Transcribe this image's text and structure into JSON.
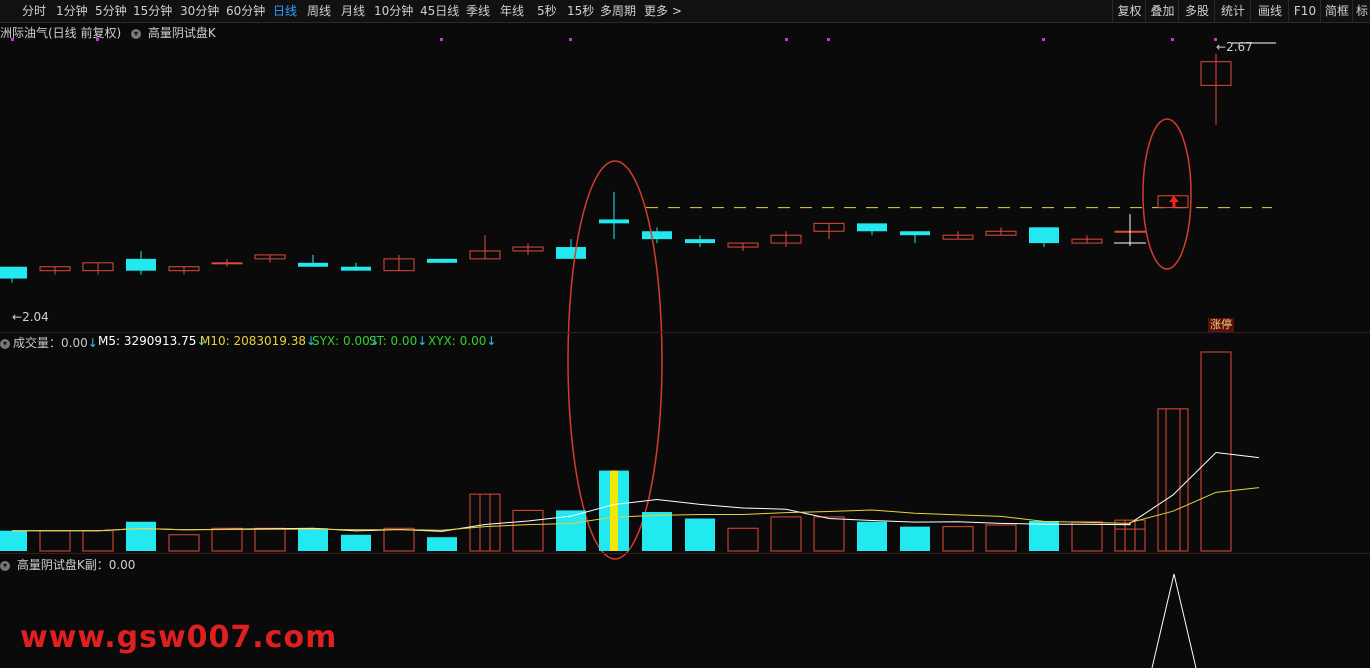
{
  "toolbar": {
    "tabs": [
      "分时",
      "1分钟",
      "5分钟",
      "15分钟",
      "30分钟",
      "60分钟",
      "日线",
      "周线",
      "月线",
      "10分钟",
      "45日线",
      "季线",
      "年线",
      "5秒",
      "15秒",
      "多周期",
      "更多 >"
    ],
    "active_tab": "日线",
    "right_buttons": [
      "复权",
      "叠加",
      "多股",
      "统计",
      "画线",
      "F10",
      "简框",
      "标"
    ]
  },
  "main_chart": {
    "title": "洲际油气(日线 前复权)",
    "indicator_name": "高量阴试盘K",
    "high_label": "2.67",
    "low_label": "2.04",
    "badge": "涨停",
    "colors": {
      "up": "#e04a3a",
      "down": "#22e8f0",
      "dash": "#e8d23a",
      "ellipse": "#d43a30"
    }
  },
  "volume_panel": {
    "items": [
      {
        "label": "成交量：0.00",
        "color": "#c8c8c8"
      },
      {
        "label": "M5: 3290913.75",
        "color": "#ffffff"
      },
      {
        "label": "M10: 2083019.38",
        "color": "#e8d23a"
      },
      {
        "label": "SYX: 0.00",
        "color": "#30d030"
      },
      {
        "label": "ST: 0.00",
        "color": "#30d030"
      },
      {
        "label": "XYX: 0.00",
        "color": "#30d030"
      }
    ]
  },
  "sub_panel": {
    "label": "高量阴试盘K副：0.00"
  },
  "watermark": "www.gsw007.com",
  "chart_data": {
    "type": "candlestick",
    "ylim": [
      2.0,
      2.7
    ],
    "candles": [
      {
        "o": 2.13,
        "c": 2.1,
        "h": 2.13,
        "l": 2.09
      },
      {
        "o": 2.12,
        "c": 2.13,
        "h": 2.13,
        "l": 2.11
      },
      {
        "o": 2.12,
        "c": 2.14,
        "h": 2.14,
        "l": 2.11
      },
      {
        "o": 2.15,
        "c": 2.12,
        "h": 2.17,
        "l": 2.11
      },
      {
        "o": 2.12,
        "c": 2.13,
        "h": 2.13,
        "l": 2.11
      },
      {
        "o": 2.14,
        "c": 2.14,
        "h": 2.15,
        "l": 2.13
      },
      {
        "o": 2.15,
        "c": 2.16,
        "h": 2.16,
        "l": 2.14
      },
      {
        "o": 2.14,
        "c": 2.13,
        "h": 2.16,
        "l": 2.13
      },
      {
        "o": 2.13,
        "c": 2.12,
        "h": 2.14,
        "l": 2.12
      },
      {
        "o": 2.12,
        "c": 2.15,
        "h": 2.16,
        "l": 2.12
      },
      {
        "o": 2.15,
        "c": 2.14,
        "h": 2.15,
        "l": 2.14
      },
      {
        "o": 2.15,
        "c": 2.17,
        "h": 2.21,
        "l": 2.15
      },
      {
        "o": 2.17,
        "c": 2.18,
        "h": 2.19,
        "l": 2.16
      },
      {
        "o": 2.18,
        "c": 2.15,
        "h": 2.2,
        "l": 2.15
      },
      {
        "o": 2.25,
        "c": 2.24,
        "h": 2.32,
        "l": 2.2
      },
      {
        "o": 2.22,
        "c": 2.2,
        "h": 2.23,
        "l": 2.19
      },
      {
        "o": 2.2,
        "c": 2.19,
        "h": 2.21,
        "l": 2.18
      },
      {
        "o": 2.18,
        "c": 2.19,
        "h": 2.19,
        "l": 2.17
      },
      {
        "o": 2.19,
        "c": 2.21,
        "h": 2.22,
        "l": 2.18
      },
      {
        "o": 2.22,
        "c": 2.24,
        "h": 2.24,
        "l": 2.2
      },
      {
        "o": 2.24,
        "c": 2.22,
        "h": 2.24,
        "l": 2.21
      },
      {
        "o": 2.22,
        "c": 2.21,
        "h": 2.22,
        "l": 2.19
      },
      {
        "o": 2.2,
        "c": 2.21,
        "h": 2.22,
        "l": 2.2
      },
      {
        "o": 2.21,
        "c": 2.22,
        "h": 2.23,
        "l": 2.21
      },
      {
        "o": 2.23,
        "c": 2.19,
        "h": 2.23,
        "l": 2.18
      },
      {
        "o": 2.19,
        "c": 2.2,
        "h": 2.21,
        "l": 2.19
      },
      {
        "o": 2.22,
        "c": 2.22,
        "h": 2.26,
        "l": 2.21
      },
      {
        "o": 2.28,
        "c": 2.31,
        "h": 2.31,
        "l": 2.28
      },
      {
        "o": 2.59,
        "c": 2.65,
        "h": 2.67,
        "l": 2.49
      }
    ],
    "dash_level": 2.28,
    "volumes": [
      0.25,
      0.25,
      0.25,
      0.36,
      0.2,
      0.28,
      0.28,
      0.28,
      0.2,
      0.28,
      0.17,
      0.7,
      0.5,
      0.5,
      0.99,
      0.48,
      0.4,
      0.28,
      0.42,
      0.42,
      0.36,
      0.3,
      0.3,
      0.32,
      0.37,
      0.36,
      0.27,
      0.38,
      1.25,
      1.75,
      2.45
    ],
    "vol_ylim": [
      0,
      2.45
    ]
  }
}
